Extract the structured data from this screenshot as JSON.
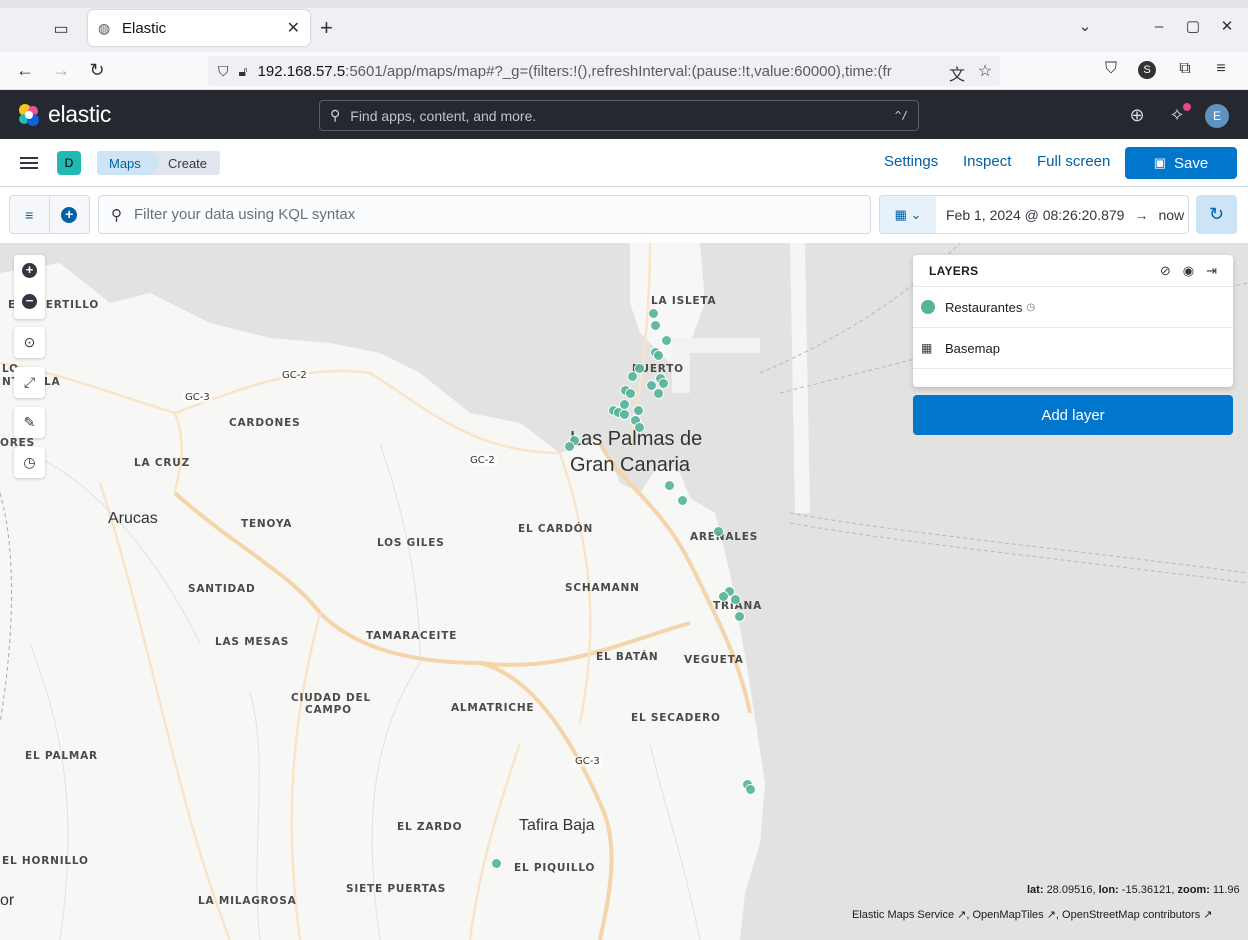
{
  "browser": {
    "tab_title": "Elastic",
    "url_host": "192.168.57.5",
    "url_rest": ":5601/app/maps/map#?_g=(filters:!(),refreshInterval:(pause:!t,value:60000),time:(fr"
  },
  "header": {
    "logo_text": "elastic",
    "search_placeholder": "Find apps, content, and more.",
    "search_shortcut": "^/",
    "avatar_initial": "E"
  },
  "appbar": {
    "space_initial": "D",
    "breadcrumbs": [
      "Maps",
      "Create"
    ],
    "links": [
      "Settings",
      "Inspect",
      "Full screen"
    ],
    "save_label": "Save"
  },
  "query": {
    "placeholder": "Filter your data using KQL syntax",
    "start": "Feb 1, 2024 @ 08:26:20.879",
    "end": "now"
  },
  "layers_panel": {
    "title": "LAYERS",
    "layers": [
      {
        "name": "Restaurantes",
        "color": "#54b399"
      },
      {
        "name": "Basemap"
      }
    ],
    "add_label": "Add layer"
  },
  "map": {
    "labels_small": [
      "EL PUERTILLO",
      "LA ISLETA",
      "PUERTO",
      "CARDONES",
      "LA CRUZ",
      "TENOYA",
      "LOS GILES",
      "EL CARDÓN",
      "ARENALES",
      "SANTIDAD",
      "SCHAMANN",
      "TRIANA",
      "LAS MESAS",
      "TAMARACEITE",
      "EL BATÁN",
      "VEGUETA",
      "CIUDAD DEL",
      "CAMPO",
      "ALMATRICHE",
      "EL SECADERO",
      "EL PALMAR",
      "EL ZARDO",
      "EL PIQUILLO",
      "EL HORNILLO",
      "SIETE PUERTAS",
      "LA MILAGROSA",
      "ORES",
      "LO",
      "NT",
      "LA"
    ],
    "labels_big": [
      "Las Palmas de",
      "Gran Canaria",
      "Arucas",
      "Tafira Baja",
      "or"
    ],
    "roads": [
      "GC-2",
      "GC-3",
      "GC-2",
      "GC-3"
    ],
    "coords_lat_label": "lat:",
    "coords_lat": "28.09516,",
    "coords_lon_label": "lon:",
    "coords_lon": "-15.36121,",
    "coords_zoom_label": "zoom:",
    "coords_zoom": "11.96",
    "attribution": [
      "Elastic Maps Service",
      "OpenMapTiles",
      "OpenStreetMap contributors"
    ]
  },
  "colors": {
    "header_bg": "#25282f",
    "primary": "#0077cc",
    "point": "#54b399"
  }
}
